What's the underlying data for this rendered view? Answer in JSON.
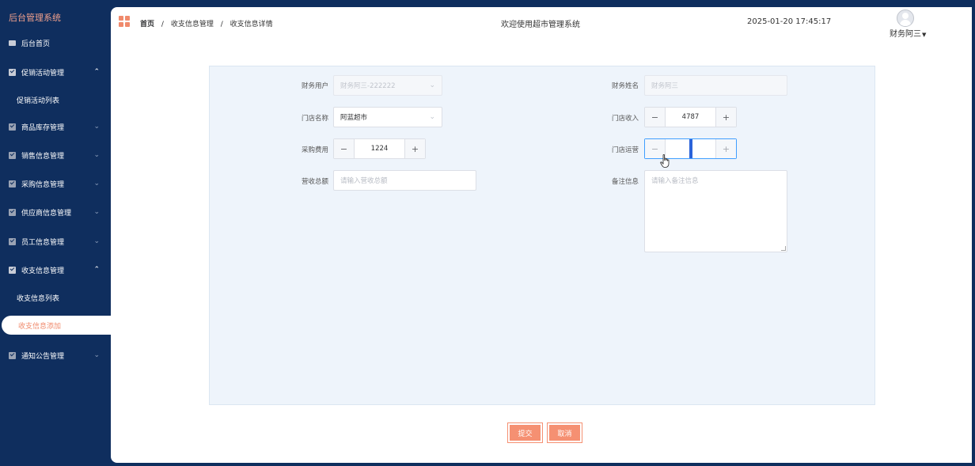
{
  "sidebar": {
    "logo": "后台管理系统",
    "items": [
      {
        "label": "后台首页",
        "icon": "monitor-icon"
      },
      {
        "label": "促销活动管理",
        "icon": "checkbox-icon",
        "expanded": true
      },
      {
        "label": "促销活动列表"
      },
      {
        "label": "商品库存管理",
        "icon": "checkbox-icon"
      },
      {
        "label": "销售信息管理",
        "icon": "checkbox-icon"
      },
      {
        "label": "采购信息管理",
        "icon": "checkbox-icon"
      },
      {
        "label": "供应商信息管理",
        "icon": "checkbox-icon"
      },
      {
        "label": "员工信息管理",
        "icon": "checkbox-icon"
      },
      {
        "label": "收支信息管理",
        "icon": "checkbox-icon",
        "expanded": true
      },
      {
        "label": "收支信息列表"
      },
      {
        "label": "收支信息添加",
        "active": true
      },
      {
        "label": "通知公告管理",
        "icon": "checkbox-icon"
      }
    ]
  },
  "header": {
    "breadcrumb": [
      "首页",
      "收支信息管理",
      "收支信息详情"
    ],
    "welcome": "欢迎使用超市管理系统",
    "datetime": "2025-01-20 17:45:17",
    "user": "财务阿三"
  },
  "form": {
    "finance_user": {
      "label": "财务用户",
      "value": "财务阿三-222222"
    },
    "finance_name": {
      "label": "财务姓名",
      "value": "财务阿三"
    },
    "store_name": {
      "label": "门店名称",
      "value": "阿蓝超市"
    },
    "store_income": {
      "label": "门店收入",
      "value": "4787"
    },
    "purchase_cost": {
      "label": "采购费用",
      "value": "1224"
    },
    "store_operation": {
      "label": "门店运营",
      "value": ""
    },
    "total_revenue": {
      "label": "营收总额",
      "placeholder": "请输入营收总额"
    },
    "remarks": {
      "label": "备注信息",
      "placeholder": "请输入备注信息"
    }
  },
  "actions": {
    "submit": "提交",
    "cancel": "取消"
  },
  "colors": {
    "sidebar_bg": "#0f2e5e",
    "accent": "#f59072",
    "panel_bg": "#eef4fb"
  }
}
